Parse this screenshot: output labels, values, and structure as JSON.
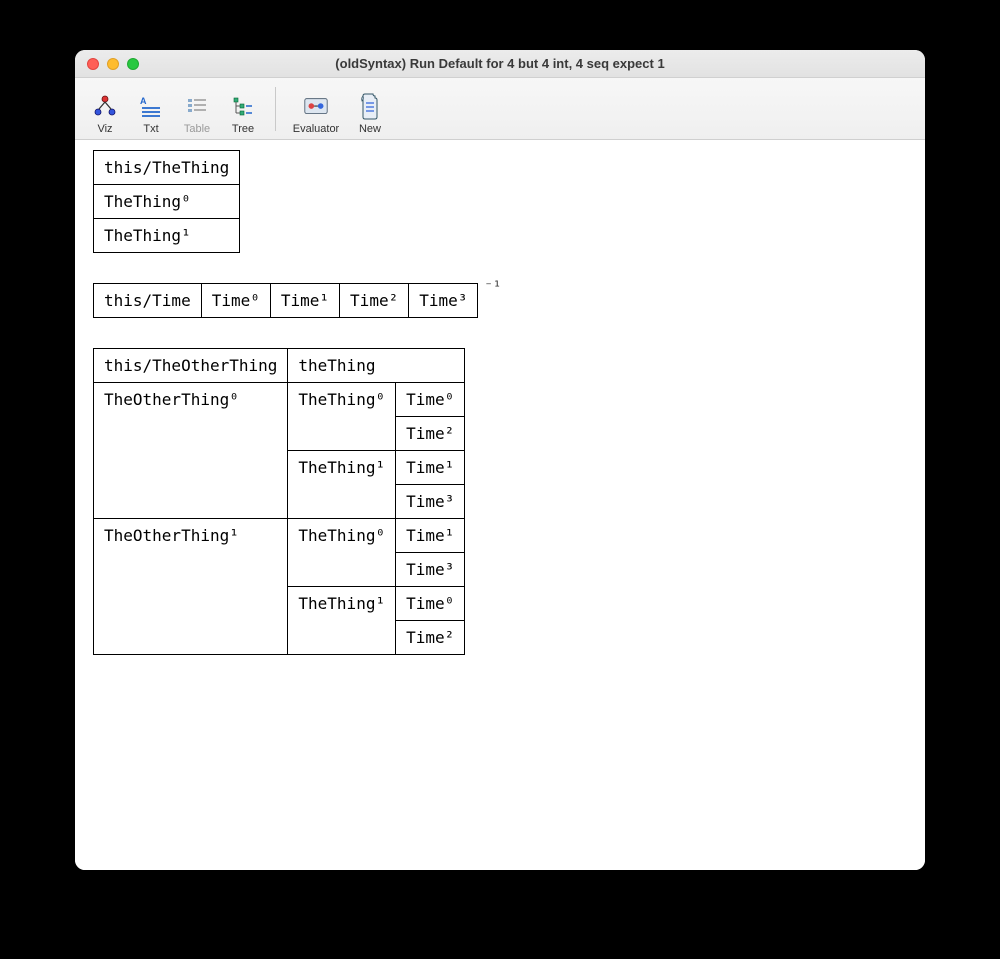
{
  "window": {
    "title": "(oldSyntax) Run Default for 4 but 4 int, 4 seq expect 1"
  },
  "traffic": {
    "close": "close",
    "min": "minimize",
    "max": "zoom"
  },
  "toolbar": {
    "viz": "Viz",
    "txt": "Txt",
    "table": "Table",
    "tree": "Tree",
    "evaluator": "Evaluator",
    "newbtn": "New"
  },
  "tables": {
    "thing": {
      "header": "this/TheThing",
      "rows": [
        "TheThing⁰",
        "TheThing¹"
      ]
    },
    "time": {
      "cells": [
        "this/Time",
        "Time⁰",
        "Time¹",
        "Time²",
        "Time³"
      ],
      "annotation": "⁻¹"
    },
    "other": {
      "header": [
        "this/TheOtherThing",
        "theThing"
      ],
      "rows": [
        {
          "other": "TheOtherThing⁰",
          "groups": [
            {
              "thing": "TheThing⁰",
              "times": [
                "Time⁰",
                "Time²"
              ]
            },
            {
              "thing": "TheThing¹",
              "times": [
                "Time¹",
                "Time³"
              ]
            }
          ]
        },
        {
          "other": "TheOtherThing¹",
          "groups": [
            {
              "thing": "TheThing⁰",
              "times": [
                "Time¹",
                "Time³"
              ]
            },
            {
              "thing": "TheThing¹",
              "times": [
                "Time⁰",
                "Time²"
              ]
            }
          ]
        }
      ]
    }
  }
}
